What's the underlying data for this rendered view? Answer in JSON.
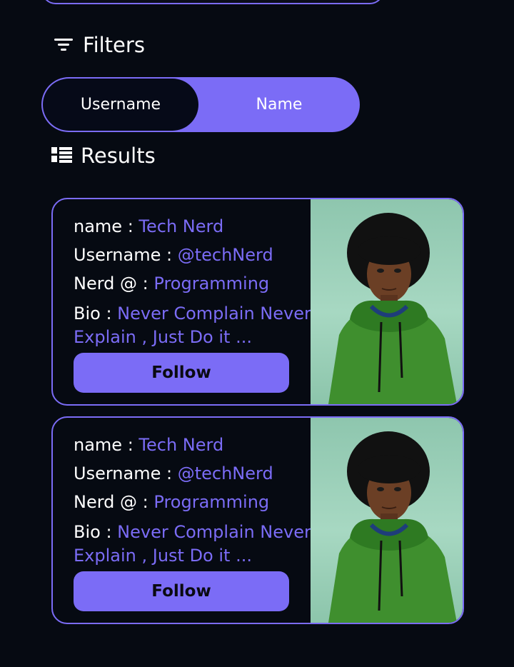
{
  "filters": {
    "title": "Filters",
    "icon": "filter-icon",
    "options": [
      {
        "label": "Username",
        "active": true
      },
      {
        "label": "Name",
        "active": false
      }
    ]
  },
  "results": {
    "title": "Results",
    "icon": "list-icon",
    "cards": [
      {
        "name_label": "name :",
        "name": "Tech Nerd",
        "username_label": "Username :",
        "username": "@techNerd",
        "nerd_label": "Nerd @ :",
        "nerd": "Programming",
        "bio_label": "Bio :",
        "bio": "Never Complain Never Explain , Just Do it ...",
        "follow_label": "Follow"
      },
      {
        "name_label": "name :",
        "name": "Tech Nerd",
        "username_label": "Username :",
        "username": "@techNerd",
        "nerd_label": "Nerd @ :",
        "nerd": "Programming",
        "bio_label": "Bio :",
        "bio": "Never Complain Never Explain , Just Do it ...",
        "follow_label": "Follow"
      }
    ]
  },
  "colors": {
    "background": "#060a12",
    "accent": "#7b6cf6",
    "text": "#ffffff"
  }
}
